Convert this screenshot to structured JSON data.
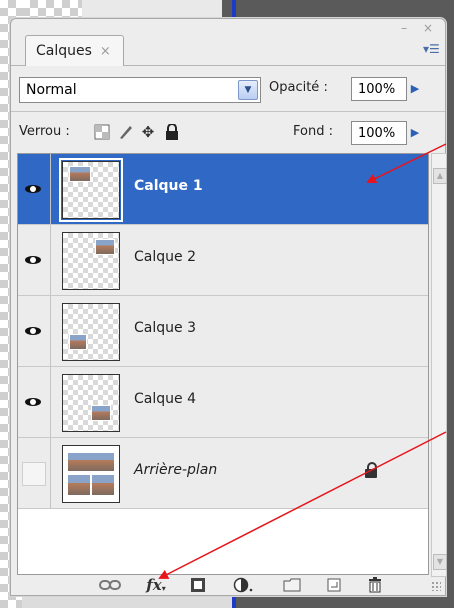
{
  "panel": {
    "tab_label": "Calques",
    "tab_close": "×",
    "window_controls": "– ×",
    "menu_icon": "▾☰"
  },
  "blend": {
    "mode": "Normal",
    "opacity_label": "Opacité :",
    "opacity_value": "100%"
  },
  "lock": {
    "label": "Verrou :",
    "fill_label": "Fond :",
    "fill_value": "100%",
    "icons": [
      "lock-transparent-icon",
      "lock-image-icon",
      "lock-position-icon",
      "lock-all-icon"
    ]
  },
  "layers": [
    {
      "name": "Calque 1",
      "visible": true,
      "selected": true,
      "italic": false,
      "locked": false
    },
    {
      "name": "Calque 2",
      "visible": true,
      "selected": false,
      "italic": false,
      "locked": false
    },
    {
      "name": "Calque 3",
      "visible": true,
      "selected": false,
      "italic": false,
      "locked": false
    },
    {
      "name": "Calque 4",
      "visible": true,
      "selected": false,
      "italic": false,
      "locked": false
    },
    {
      "name": "Arrière-plan",
      "visible": false,
      "selected": false,
      "italic": true,
      "locked": true
    }
  ],
  "bottom_icons": [
    "link-layers-icon",
    "fx-styles-icon",
    "add-mask-icon",
    "adjustment-layer-icon",
    "new-group-icon",
    "new-layer-icon",
    "trash-icon"
  ],
  "bottom_fx_label": "fx",
  "colors": {
    "selected_row": "#2f69c5",
    "annotation_arrow": "#e8141b",
    "accent_arrow": "#2c5fb8"
  }
}
